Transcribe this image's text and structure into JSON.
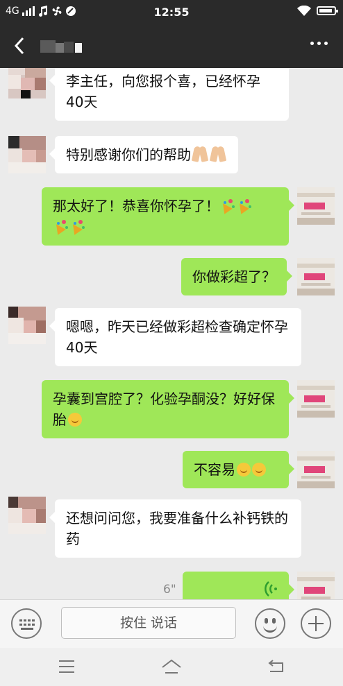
{
  "status_bar": {
    "network": "4G",
    "time": "12:55"
  },
  "header": {
    "contact_name_blurred": true
  },
  "messages": [
    {
      "side": "in",
      "text": "李主任，向您报个喜，已经怀孕40天"
    },
    {
      "side": "in",
      "text": "特别感谢你们的帮助",
      "emoji": "praying-hands"
    },
    {
      "side": "out",
      "text": "那太好了！恭喜你怀孕了！",
      "emoji": "party-popper"
    },
    {
      "side": "out",
      "text": "你做彩超了？"
    },
    {
      "side": "in",
      "text": "嗯嗯，昨天已经做彩超检查确定怀孕40天"
    },
    {
      "side": "out",
      "text": "孕囊到宫腔了？化验孕酮没？好好保胎",
      "emoji": "smile"
    },
    {
      "side": "out",
      "text": "不容易",
      "emoji": "smile"
    },
    {
      "side": "in",
      "text": "还想问问您，我要准备什么补钙铁的药"
    },
    {
      "side": "out",
      "type": "voice",
      "duration": "6\""
    }
  ],
  "input_bar": {
    "hold_to_talk_label": "按住 说话"
  },
  "colors": {
    "bar_dark": "#2a2a2a",
    "chat_bg": "#ebebeb",
    "outgoing_bubble": "#9fe758",
    "incoming_bubble": "#ffffff",
    "voice_wave": "#2f9e2f"
  }
}
